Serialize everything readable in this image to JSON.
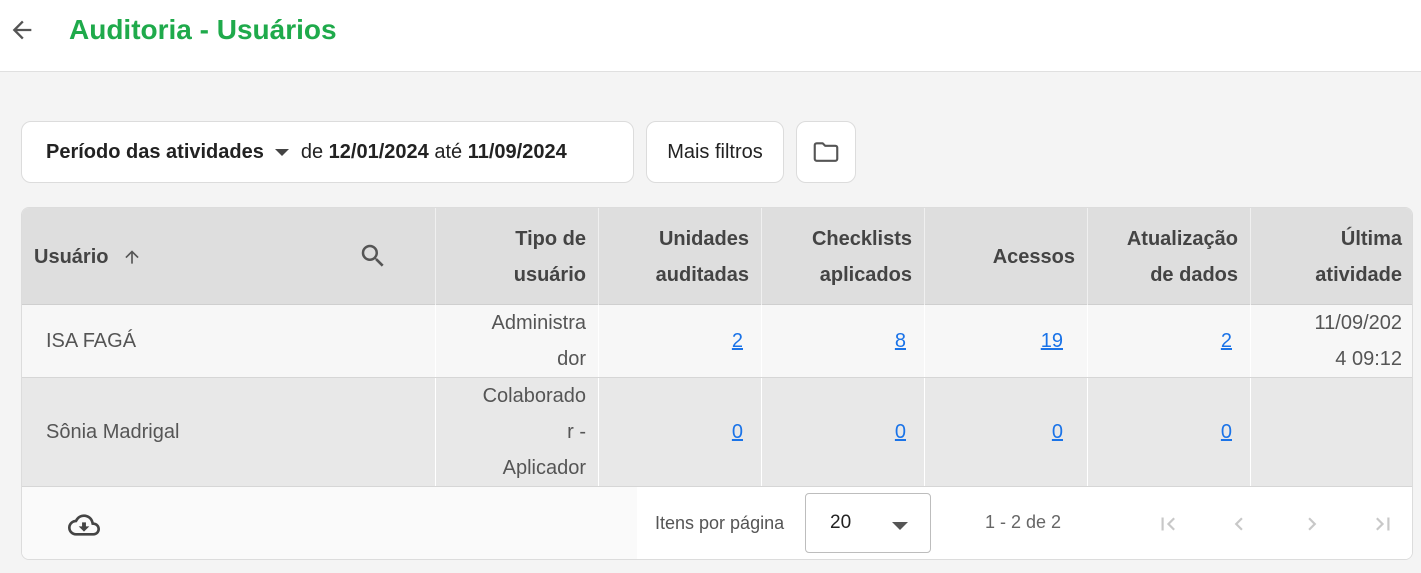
{
  "header": {
    "title": "Auditoria - Usuários"
  },
  "filters": {
    "period_label": "Período das atividades",
    "from_prefix": "de",
    "from_date": "12/01/2024",
    "to_prefix": "até",
    "to_date": "11/09/2024",
    "more_filters": "Mais filtros"
  },
  "table": {
    "columns": [
      "Usuário",
      "Tipo de\nusuário",
      "Unidades\nauditadas",
      "Checklists\naplicados",
      "Acessos",
      "Atualização\nde dados",
      "Última\natividade"
    ],
    "rows": [
      {
        "user": "ISA FAGÁ",
        "type": "Administra\ndor",
        "units": "2",
        "checklists": "8",
        "accesses": "19",
        "updates": "2",
        "last": "11/09/202\n4 09:12"
      },
      {
        "user": "Sônia Madrigal",
        "type": "Colaborado\nr -\nAplicador",
        "units": "0",
        "checklists": "0",
        "accesses": "0",
        "updates": "0",
        "last": ""
      }
    ]
  },
  "pagination": {
    "items_per_page_label": "Itens por página",
    "items_per_page": "20",
    "range": "1 - 2 de 2"
  },
  "colors": {
    "title": "#1faa4b",
    "link": "#1a73e8",
    "header_bg": "#dedede"
  }
}
